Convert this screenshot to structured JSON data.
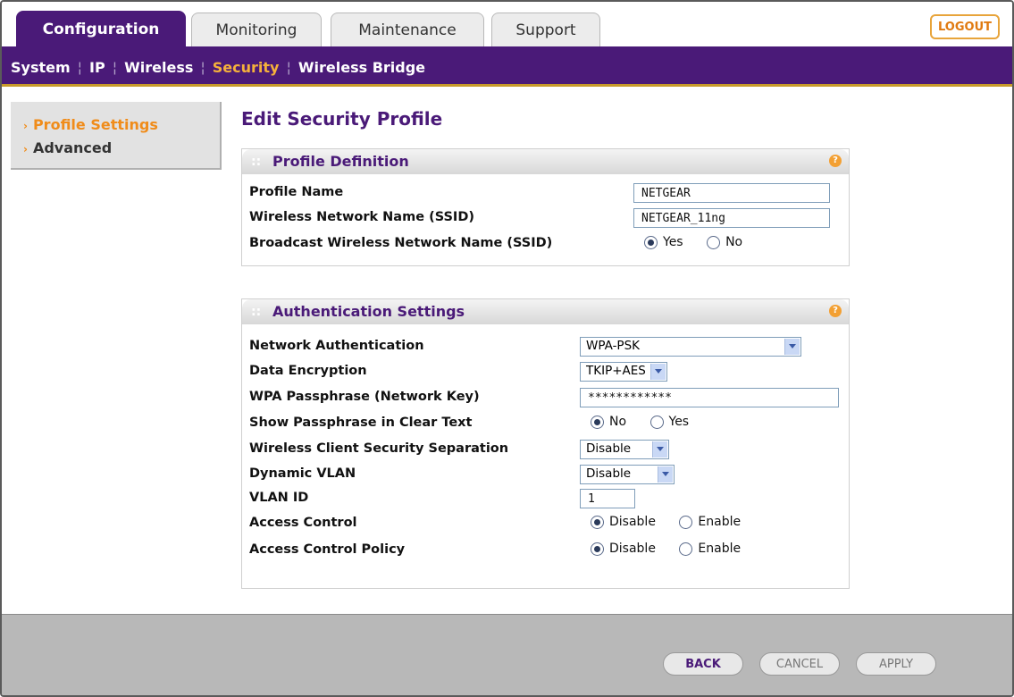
{
  "tabs": [
    {
      "label": "Configuration",
      "active": true
    },
    {
      "label": "Monitoring",
      "active": false
    },
    {
      "label": "Maintenance",
      "active": false
    },
    {
      "label": "Support",
      "active": false
    }
  ],
  "logout_label": "LOGOUT",
  "subnav": [
    {
      "label": "System",
      "active": false
    },
    {
      "label": "IP",
      "active": false
    },
    {
      "label": "Wireless",
      "active": false
    },
    {
      "label": "Security",
      "active": true
    },
    {
      "label": "Wireless Bridge",
      "active": false
    }
  ],
  "sidebar": {
    "items": [
      {
        "label": "Profile Settings",
        "active": true
      },
      {
        "label": "Advanced",
        "active": false
      }
    ]
  },
  "page_title": "Edit Security Profile",
  "profile_definition": {
    "title": "Profile Definition",
    "profile_name_label": "Profile Name",
    "profile_name_value": "NETGEAR",
    "ssid_label": "Wireless Network Name (SSID)",
    "ssid_value": "NETGEAR_11ng",
    "broadcast_label": "Broadcast Wireless Network Name (SSID)",
    "broadcast_options": [
      "Yes",
      "No"
    ],
    "broadcast_selected": "Yes"
  },
  "auth_settings": {
    "title": "Authentication Settings",
    "network_auth_label": "Network Authentication",
    "network_auth_value": "WPA-PSK",
    "data_encryption_label": "Data Encryption",
    "data_encryption_value": "TKIP+AES",
    "passphrase_label": "WPA Passphrase (Network Key)",
    "passphrase_value": "************",
    "show_passphrase_label": "Show Passphrase in Clear Text",
    "show_passphrase_options": [
      "No",
      "Yes"
    ],
    "show_passphrase_selected": "No",
    "client_separation_label": "Wireless Client Security Separation",
    "client_separation_value": "Disable",
    "dynamic_vlan_label": "Dynamic VLAN",
    "dynamic_vlan_value": "Disable",
    "vlan_id_label": "VLAN ID",
    "vlan_id_value": "1",
    "access_control_label": "Access Control",
    "access_control_options": [
      "Disable",
      "Enable"
    ],
    "access_control_selected": "Disable",
    "access_control_policy_label": "Access Control Policy",
    "access_control_policy_options": [
      "Disable",
      "Enable"
    ],
    "access_control_policy_selected": "Disable"
  },
  "buttons": {
    "back": "BACK",
    "cancel": "CANCEL",
    "apply": "APPLY"
  },
  "colors": {
    "brand_purple": "#4a1a78",
    "accent_orange": "#f08c1a"
  }
}
